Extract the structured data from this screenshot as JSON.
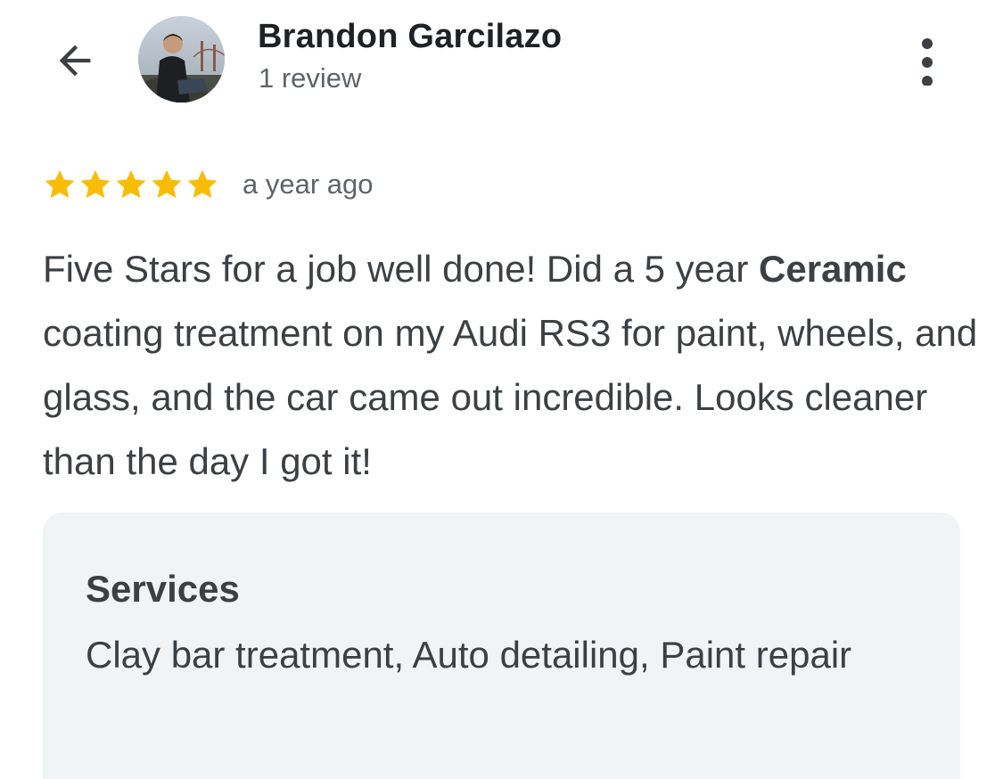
{
  "header": {
    "back_icon": "arrow-left-icon",
    "reviewer_name": "Brandon Garcilazo",
    "review_count": "1 review",
    "more_icon": "more-vertical-icon"
  },
  "review": {
    "rating": 5,
    "max_rating": 5,
    "star_color": "#f9bc05",
    "date": "a year ago",
    "text_lead": "Five Stars for a job well done! Did a 5 year ",
    "text_bold": "Ceramic",
    "text_tail": " coating treatment on my Audi RS3 for paint, wheels, and glass, and the car came out incredible. Looks cleaner than the day I got it!"
  },
  "services": {
    "title": "Services",
    "list": "Clay bar treatment, Auto detailing, Paint repair"
  }
}
